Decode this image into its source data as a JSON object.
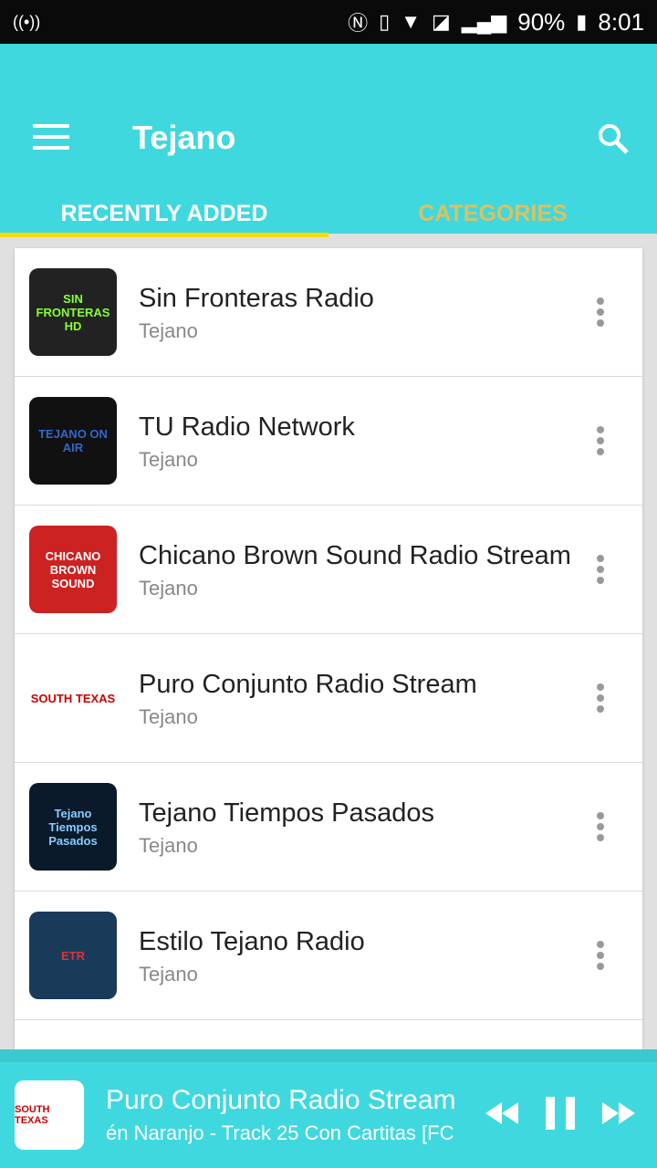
{
  "status_bar": {
    "battery": "90%",
    "time": "8:01"
  },
  "app_bar": {
    "title": "Tejano"
  },
  "tabs": [
    {
      "label": "RECENTLY ADDED",
      "active": true
    },
    {
      "label": "CATEGORIES",
      "active": false
    }
  ],
  "stations": [
    {
      "name": "Sin Fronteras Radio",
      "category": "Tejano",
      "logo_text": "SIN FRONTERAS HD"
    },
    {
      "name": "TU Radio Network",
      "category": "Tejano",
      "logo_text": "TEJANO ON AIR"
    },
    {
      "name": "Chicano Brown Sound Radio Stream",
      "category": "Tejano",
      "logo_text": "CHICANO BROWN SOUND"
    },
    {
      "name": "Puro Conjunto Radio Stream",
      "category": "Tejano",
      "logo_text": "SOUTH TEXAS"
    },
    {
      "name": "Tejano Tiempos Pasados",
      "category": "Tejano",
      "logo_text": "Tejano Tiempos Pasados"
    },
    {
      "name": "Estilo Tejano Radio",
      "category": "Tejano",
      "logo_text": "ETR"
    }
  ],
  "player": {
    "title": "Puro Conjunto Radio Stream",
    "subtitle": "én Naranjo - Track 25 Con Cartitas [FC",
    "logo_text": "SOUTH TEXAS"
  }
}
